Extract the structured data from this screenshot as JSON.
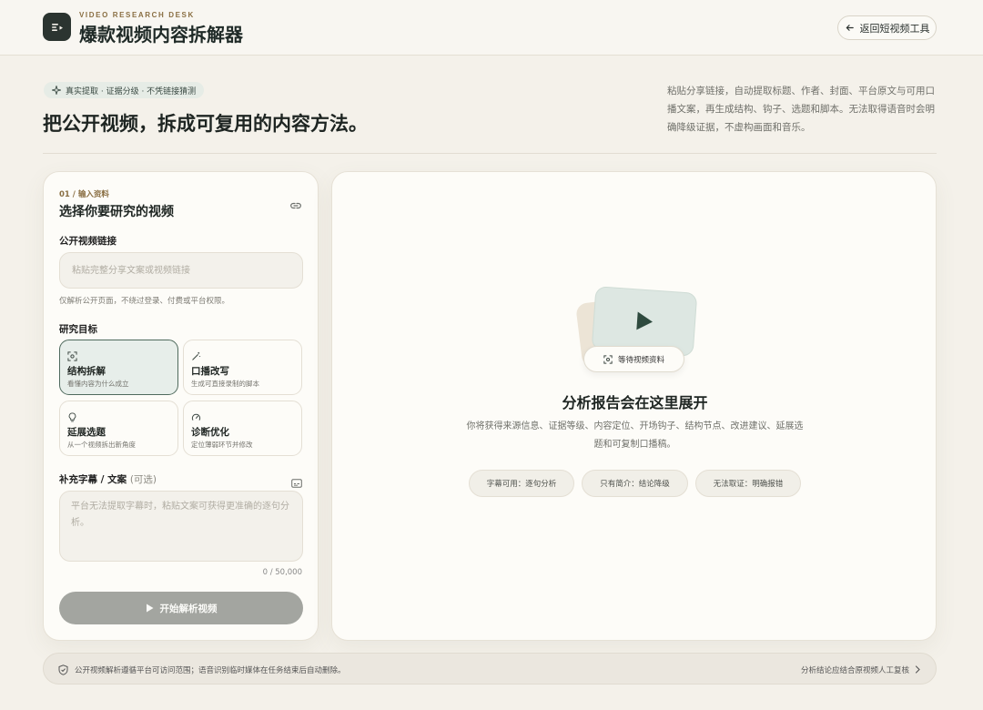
{
  "header": {
    "brand_sub": "VIDEO RESEARCH DESK",
    "brand_title": "爆款视频内容拆解器",
    "back_label": "返回短视频工具"
  },
  "hero": {
    "tag": "真实提取 · 证据分级 · 不凭链接猜测",
    "title": "把公开视频，拆成可复用的内容方法。",
    "description": "粘贴分享链接，自动提取标题、作者、封面、平台原文与可用口播文案，再生成结构、钩子、选题和脚本。无法取得语音时会明确降级证据，不虚构画面和音乐。"
  },
  "input_card": {
    "step": "01 / 输入资料",
    "title": "选择你要研究的视频",
    "url_label": "公开视频链接",
    "url_placeholder": "粘贴完整分享文案或视频链接",
    "url_value": "",
    "hint": "仅解析公开页面，不绕过登录、付费或平台权限。",
    "goal_label": "研究目标",
    "goals": [
      {
        "title": "结构拆解",
        "desc": "看懂内容为什么成立",
        "icon": "scan-icon",
        "active": true
      },
      {
        "title": "口播改写",
        "desc": "生成可直接录制的脚本",
        "icon": "magic-wand-icon",
        "active": false
      },
      {
        "title": "延展选题",
        "desc": "从一个视频拆出新角度",
        "icon": "lightbulb-icon",
        "active": false
      },
      {
        "title": "诊断优化",
        "desc": "定位薄弱环节并修改",
        "icon": "gauge-icon",
        "active": false
      }
    ],
    "transcript_label": "补充字幕 / 文案",
    "transcript_optional": "(可选)",
    "transcript_placeholder": "平台无法提取字幕时，粘贴文案可获得更准确的逐句分析。",
    "counter": "0 / 50,000",
    "start_label": "开始解析视频"
  },
  "report_card": {
    "wait_label": "等待视频资料",
    "title": "分析报告会在这里展开",
    "description": "你将获得来源信息、证据等级、内容定位、开场钩子、结构节点、改进建议、延展选题和可复制口播稿。",
    "chips": [
      "字幕可用：逐句分析",
      "只有简介：结论降级",
      "无法取证：明确报错"
    ]
  },
  "footer": {
    "notice": "公开视频解析遵循平台可访问范围；语音识别临时媒体在任务结束后自动删除。",
    "right_link": "分析结论应结合原视频人工复核"
  },
  "colors": {
    "accent_dark": "#2b3430",
    "accent_green": "#4f6a5d",
    "brand_gold": "#8a6f43",
    "background": "#f4f1ea"
  }
}
